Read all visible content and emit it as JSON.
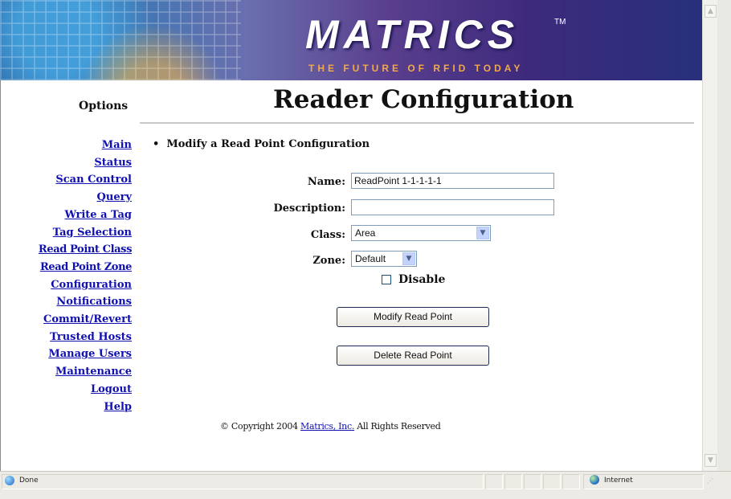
{
  "banner": {
    "logo": "MATRICS",
    "trademark": "TM",
    "tagline": "THE FUTURE OF RFID TODAY"
  },
  "sidebar": {
    "title": "Options",
    "items": [
      {
        "label": "Main"
      },
      {
        "label": "Status"
      },
      {
        "label": "Scan Control"
      },
      {
        "label": "Query"
      },
      {
        "label": "Write a Tag"
      },
      {
        "label": "Tag Selection"
      },
      {
        "label": "Read Point Class"
      },
      {
        "label": "Read Point Zone"
      },
      {
        "label": "Configuration"
      },
      {
        "label": "Notifications"
      },
      {
        "label": "Commit/Revert"
      },
      {
        "label": "Trusted Hosts"
      },
      {
        "label": "Manage Users"
      },
      {
        "label": "Maintenance"
      },
      {
        "label": "Logout"
      },
      {
        "label": "Help"
      }
    ]
  },
  "main": {
    "page_title": "Reader Configuration",
    "section_heading": "Modify a Read Point Configuration",
    "form": {
      "name_label": "Name:",
      "name_value": "ReadPoint 1-1-1-1-1",
      "description_label": "Description:",
      "description_value": "",
      "class_label": "Class:",
      "class_value": "Area",
      "zone_label": "Zone:",
      "zone_value": "Default",
      "disable_label": "Disable",
      "disable_checked": false
    },
    "buttons": {
      "modify": "Modify Read Point",
      "delete": "Delete Read Point"
    },
    "copyright": {
      "prefix": "© Copyright 2004 ",
      "link": "Matrics, Inc.",
      "suffix": "  All Rights Reserved"
    }
  },
  "statusbar": {
    "status": "Done",
    "zone": "Internet"
  }
}
